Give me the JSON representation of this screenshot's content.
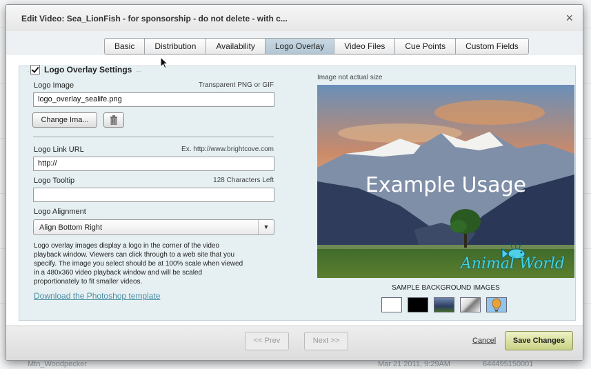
{
  "dialog": {
    "title": "Edit Video: Sea_LionFish - for sponsorship - do not delete - with c...",
    "close_glyph": "×"
  },
  "tabs": [
    {
      "label": "Basic",
      "active": false
    },
    {
      "label": "Distribution",
      "active": false
    },
    {
      "label": "Availability",
      "active": false
    },
    {
      "label": "Logo Overlay",
      "active": true
    },
    {
      "label": "Video Files",
      "active": false
    },
    {
      "label": "Cue Points",
      "active": false
    },
    {
      "label": "Custom Fields",
      "active": false
    }
  ],
  "settings": {
    "legend": "Logo Overlay Settings",
    "enabled": true,
    "logo_image_label": "Logo Image",
    "logo_image_hint": "Transparent PNG or GIF",
    "logo_image_value": "logo_overlay_sealife.png",
    "change_image_label": "Change Ima...",
    "link_url_label": "Logo Link URL",
    "link_url_hint": "Ex. http://www.brightcove.com",
    "link_url_value": "http://",
    "tooltip_label": "Logo Tooltip",
    "tooltip_hint": "128 Characters Left",
    "tooltip_value": "",
    "alignment_label": "Logo Alignment",
    "alignment_value": "Align Bottom Right",
    "description": "Logo overlay images display a logo in the corner of the video playback window. Viewers can click through to a web site that you specify. The image you select should be at 100% scale when viewed in a 480x360 video playback window and will be scaled proportionately to fit smaller videos.",
    "download_link": "Download the Photoshop template"
  },
  "preview": {
    "note": "Image not actual size",
    "example_text": "Example Usage",
    "logo_text": "Animal World",
    "sample_label": "SAMPLE BACKGROUND IMAGES"
  },
  "footer": {
    "prev": "<< Prev",
    "next": "Next >>",
    "cancel": "Cancel",
    "save": "Save Changes"
  },
  "background": {
    "row_text": "Mar 21 2011, 9:29AM",
    "row_id": "644495150001",
    "row_name": "Mtn_Woodpecker"
  },
  "colors": {
    "accent_link": "#4c8ea4",
    "active_tab": "#b3c6d4",
    "save_button": "#c9d185",
    "content_bg": "#e6f0f3"
  }
}
